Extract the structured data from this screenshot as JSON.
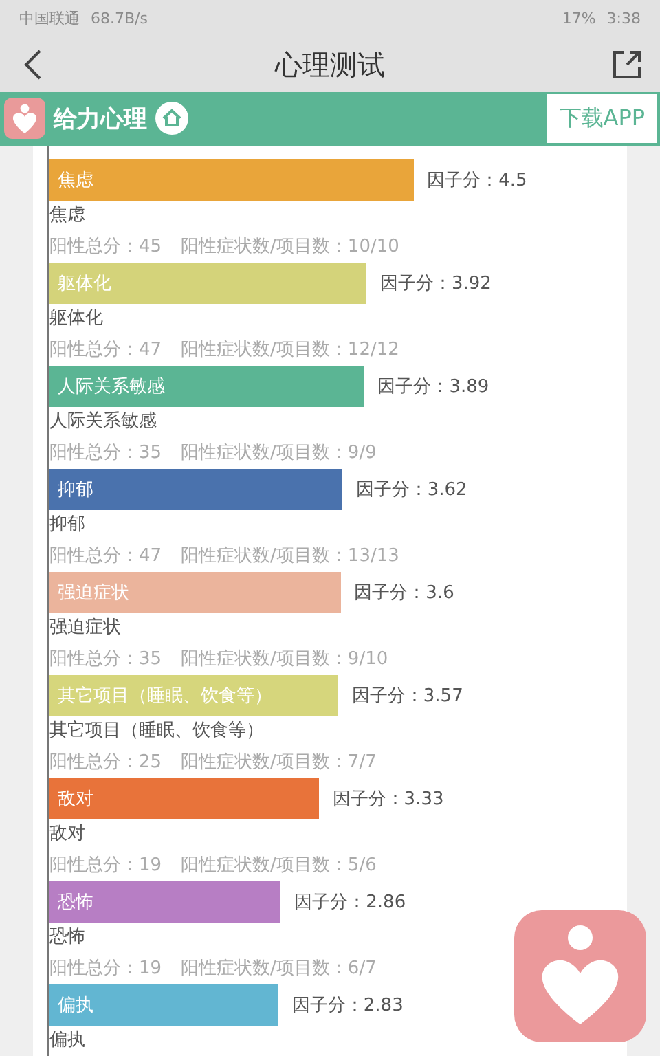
{
  "status_bar": {
    "carrier": "中国联通",
    "speed": "68.7B/s",
    "battery": "17%",
    "time": "3:38"
  },
  "title_bar": {
    "title": "心理测试"
  },
  "brand_bar": {
    "name": "给力心理",
    "download": "下载APP"
  },
  "factors": [
    {
      "name": "焦虑",
      "color": "#e9a53a",
      "score": "因子分：4.5",
      "label": "焦虑",
      "total": "阳性总分：45",
      "ratio": "阳性症状数/项目数：10/10"
    },
    {
      "name": "躯体化",
      "color": "#d4d37a",
      "score": "因子分：3.92",
      "label": "躯体化",
      "total": "阳性总分：47",
      "ratio": "阳性症状数/项目数：12/12"
    },
    {
      "name": "人际关系敏感",
      "color": "#5bb594",
      "score": "因子分：3.89",
      "label": "人际关系敏感",
      "total": "阳性总分：35",
      "ratio": "阳性症状数/项目数：9/9"
    },
    {
      "name": "抑郁",
      "color": "#4a72ad",
      "score": "因子分：3.62",
      "label": "抑郁",
      "total": "阳性总分：47",
      "ratio": "阳性症状数/项目数：13/13"
    },
    {
      "name": "强迫症状",
      "color": "#ebb49c",
      "score": "因子分：3.6",
      "label": "强迫症状",
      "total": "阳性总分：35",
      "ratio": "阳性症状数/项目数：9/10"
    },
    {
      "name": "其它项目（睡眠、饮食等）",
      "color": "#d6d67c",
      "score": "因子分：3.57",
      "label": "其它项目（睡眠、饮食等）",
      "total": "阳性总分：25",
      "ratio": "阳性症状数/项目数：7/7"
    },
    {
      "name": "敌对",
      "color": "#e8733a",
      "score": "因子分：3.33",
      "label": "敌对",
      "total": "阳性总分：19",
      "ratio": "阳性症状数/项目数：5/6"
    },
    {
      "name": "恐怖",
      "color": "#b77ec4",
      "score": "因子分：2.86",
      "label": "恐怖",
      "total": "阳性总分：19",
      "ratio": "阳性症状数/项目数：6/7"
    },
    {
      "name": "偏执",
      "color": "#62b6d2",
      "score": "因子分：2.83",
      "label": "偏执"
    }
  ]
}
